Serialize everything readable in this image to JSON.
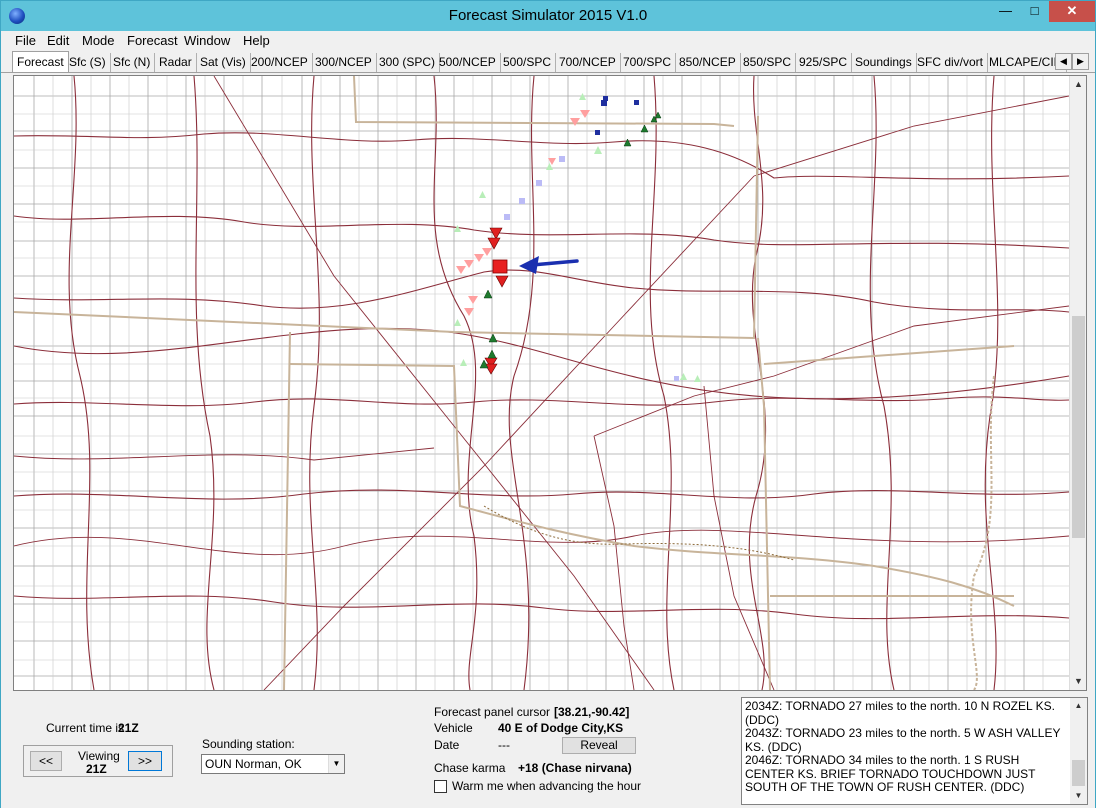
{
  "window": {
    "title": "Forecast Simulator 2015 V1.0"
  },
  "menu": [
    "File",
    "Edit",
    "Mode",
    "Forecast",
    "Window",
    "Help"
  ],
  "tabs": [
    "Forecast",
    "Sfc (S)",
    "Sfc (N)",
    "Radar",
    "Sat (Vis)",
    "200/NCEP",
    "300/NCEP",
    "300 (SPC)",
    "500/NCEP",
    "500/SPC",
    "700/NCEP",
    "700/SPC",
    "850/NCEP",
    "850/SPC",
    "925/SPC",
    "Soundings",
    "SFC div/vort",
    "MLCAPE/CIN"
  ],
  "active_tab": "Forecast",
  "status": {
    "current_time_label": "Current time is",
    "current_time": "21Z",
    "viewing_label": "Viewing",
    "viewing_time": "21Z",
    "prev_button": "<<",
    "next_button": ">>",
    "sounding_label": "Sounding station:",
    "sounding_value": "OUN  Norman, OK",
    "cursor_label": "Forecast panel cursor",
    "cursor_value": "[38.21,-90.42]",
    "vehicle_label": "Vehicle",
    "vehicle_value": "40 E of Dodge City,KS",
    "date_label": "Date",
    "date_value": "---",
    "reveal_button": "Reveal",
    "karma_label": "Chase karma",
    "karma_value": "+18 (Chase nirvana)",
    "warn_label": "Warm me when advancing the hour"
  },
  "log_text": "2034Z: TORNADO 27 miles to the north. 10 N ROZEL KS. (DDC)\n2043Z: TORNADO 23 miles to the north. 5 W ASH VALLEY KS. (DDC)\n2046Z: TORNADO 34 miles to the north. 1 S RUSH CENTER KS. BRIEF TORNADO TOUCHDOWN JUST SOUTH OF THE TOWN OF RUSH CENTER. (DDC)",
  "colors": {
    "titlebar": "#5ec3da",
    "state_border": "#c8b49a",
    "roads": "#8b2e3a",
    "counties": "#a0a0a0",
    "tornado": "#e02020",
    "vehicle_arrow": "#1a2fb0"
  },
  "icons": {
    "app": "globe-icon",
    "vehicle": "arrow-left-icon",
    "tornado": "triangle-down-icon",
    "hail": "triangle-up-icon",
    "wind": "square-icon"
  }
}
